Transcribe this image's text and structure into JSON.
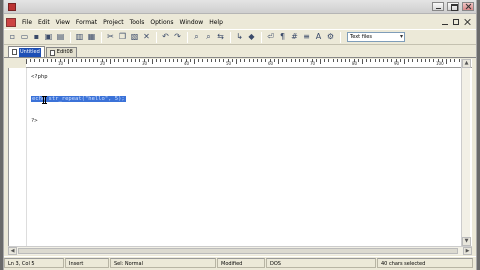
{
  "menu": {
    "items": [
      "File",
      "Edit",
      "View",
      "Format",
      "Project",
      "Tools",
      "Options",
      "Window",
      "Help"
    ]
  },
  "toolbar": {
    "filetype_select": "Text files"
  },
  "tabs": [
    {
      "label": "Untitled",
      "active": true
    },
    {
      "label": "Edit08",
      "active": false
    }
  ],
  "ruler": {
    "labels": [
      "10",
      "20",
      "30",
      "40",
      "50",
      "60",
      "70",
      "80",
      "90",
      "100",
      "110"
    ]
  },
  "editor": {
    "lines": [
      {
        "text": "<?php",
        "selected": false
      },
      {
        "text": "",
        "selected": false
      },
      {
        "text": "echo str_repeat(\"hello\", 5);",
        "selected": true
      },
      {
        "text": "",
        "selected": false
      },
      {
        "text": "?>",
        "selected": false
      }
    ]
  },
  "status": {
    "position": "Ln 3, Col 5",
    "mode": "Insert",
    "sel_mode": "Sel: Normal",
    "modified": "Modified",
    "format": "DOS",
    "selection_info": "40 chars selected"
  },
  "colors": {
    "selection": "#3b72d8",
    "active_tab": "#1d4fb5"
  }
}
